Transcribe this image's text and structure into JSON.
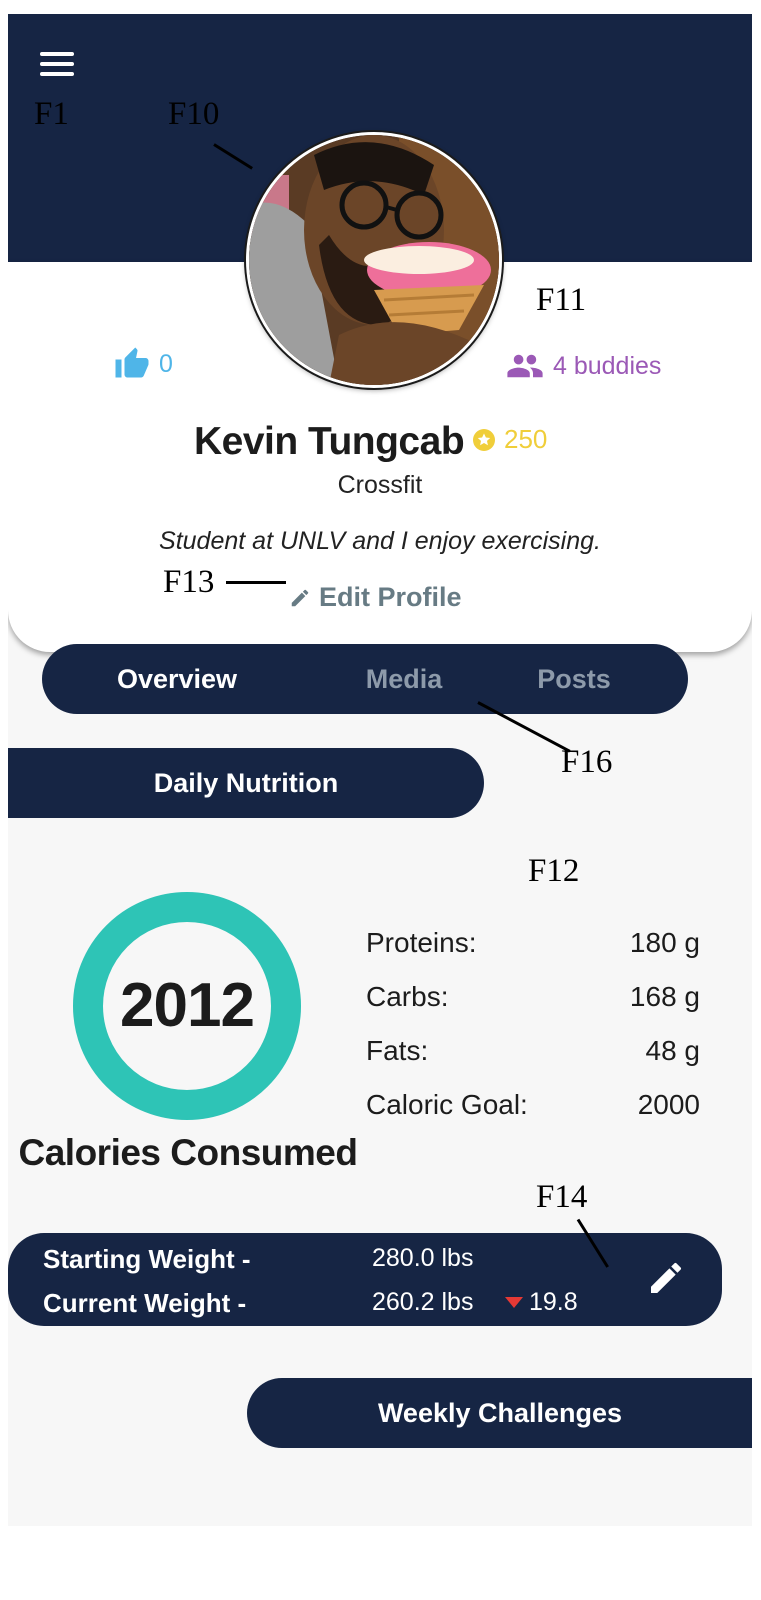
{
  "callouts": {
    "f1": "F1",
    "f10": "F10",
    "f11": "F11",
    "f12": "F12",
    "f13": "F13",
    "f14": "F14",
    "f16": "F16"
  },
  "profile": {
    "likes": "0",
    "buddies": "4 buddies",
    "name": "Kevin Tungcab",
    "points": "250",
    "sport": "Crossfit",
    "bio": "Student at UNLV and I enjoy exercising.",
    "edit_label": "Edit Profile"
  },
  "tabs": [
    "Overview",
    "Media",
    "Posts"
  ],
  "active_tab": "Overview",
  "nutrition": {
    "section_title": "Daily Nutrition",
    "calories": "2012",
    "calories_label": "Calories Consumed",
    "calorie_progress": 1.0,
    "macros": [
      {
        "label": "Proteins:",
        "value": "180 g"
      },
      {
        "label": "Carbs:",
        "value": "168 g"
      },
      {
        "label": "Fats:",
        "value": "48 g"
      },
      {
        "label": "Caloric Goal:",
        "value": "2000"
      }
    ]
  },
  "weight": {
    "starting_label": "Starting Weight -",
    "starting_value": "280.0 lbs",
    "current_label": "Current Weight -",
    "current_value": "260.2 lbs",
    "change": "19.8"
  },
  "weekly_challenges_label": "Weekly Challenges",
  "icons": {
    "menu": "menu-icon",
    "like": "thumbs-up-icon",
    "buddies": "people-icon",
    "points": "star-coin-icon",
    "edit": "pencil-icon",
    "trend": "triangle-down-icon"
  },
  "colors": {
    "navy": "#162544",
    "like_blue": "#4fb5e8",
    "buddies_purple": "#9b59b6",
    "points_gold": "#f0ce3a",
    "ring_teal": "#2ec4b6",
    "decrease_red": "#e53935"
  }
}
